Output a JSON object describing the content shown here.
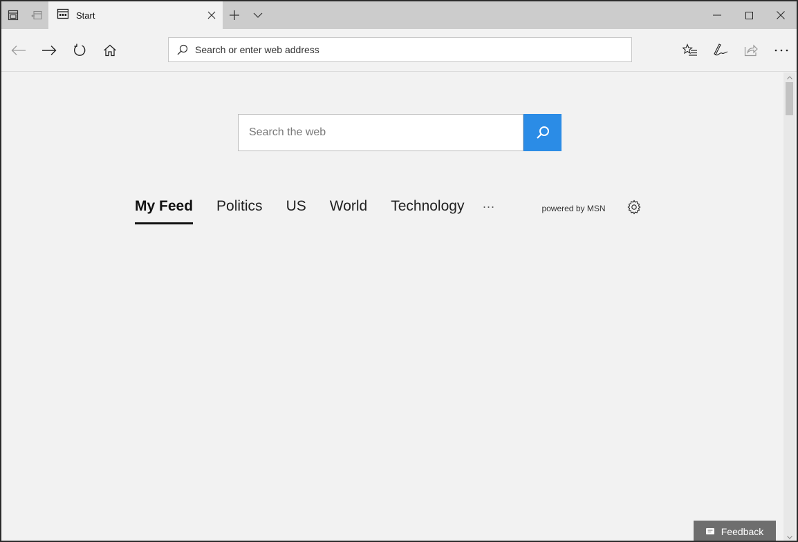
{
  "tab": {
    "title": "Start"
  },
  "address": {
    "placeholder": "Search or enter web address"
  },
  "web_search": {
    "placeholder": "Search the web"
  },
  "feed": {
    "tabs": [
      "My Feed",
      "Politics",
      "US",
      "World",
      "Technology"
    ],
    "more": "···",
    "powered_by": "powered by MSN"
  },
  "feedback": {
    "label": "Feedback"
  },
  "colors": {
    "accent": "#2b8ce6",
    "titlebar": "#cccccc",
    "page_background": "#f2f2f2",
    "feedback_button": "#6e6e6e"
  },
  "icons": {
    "tab_manager": "tab-manager-icon",
    "set_aside": "set-aside-tabs-icon",
    "tab_page": "page-icon",
    "back": "back-arrow-icon",
    "forward": "forward-arrow-icon",
    "refresh": "refresh-icon",
    "home": "home-icon",
    "search": "search-icon",
    "favorites": "favorites-icon",
    "notes": "pen-icon",
    "share": "share-icon",
    "more": "more-icon",
    "settings": "gear-icon"
  }
}
